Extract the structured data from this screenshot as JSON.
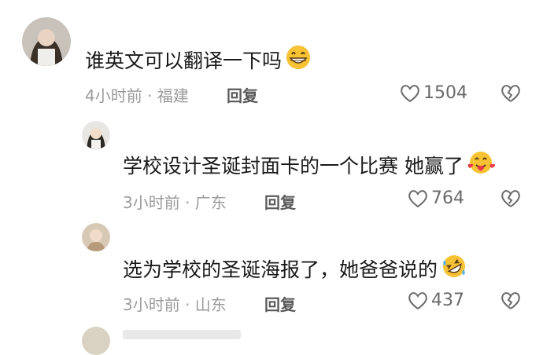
{
  "comments": [
    {
      "text": "谁英文可以翻译一下吗",
      "emoji_icon": "grinning-face-icon",
      "meta": "4小时前 · 福建",
      "reply": "回复",
      "likes": "1504"
    },
    {
      "text": "学校设计圣诞封面卡的一个比赛 她赢了",
      "emoji_icon": "smiling-face-with-hearts-icon",
      "meta": "3小时前 · 广东",
      "reply": "回复",
      "likes": "764"
    },
    {
      "text": "选为学校的圣诞海报了，她爸爸说的",
      "emoji_icon": "rolling-on-floor-laughing-icon",
      "meta": "3小时前 · 山东",
      "reply": "回复",
      "likes": "437"
    }
  ],
  "colors": {
    "text": "#1a1a1a",
    "meta": "#9b9b9b",
    "reply": "#5a5a5a",
    "emoji": "#f7c234"
  }
}
